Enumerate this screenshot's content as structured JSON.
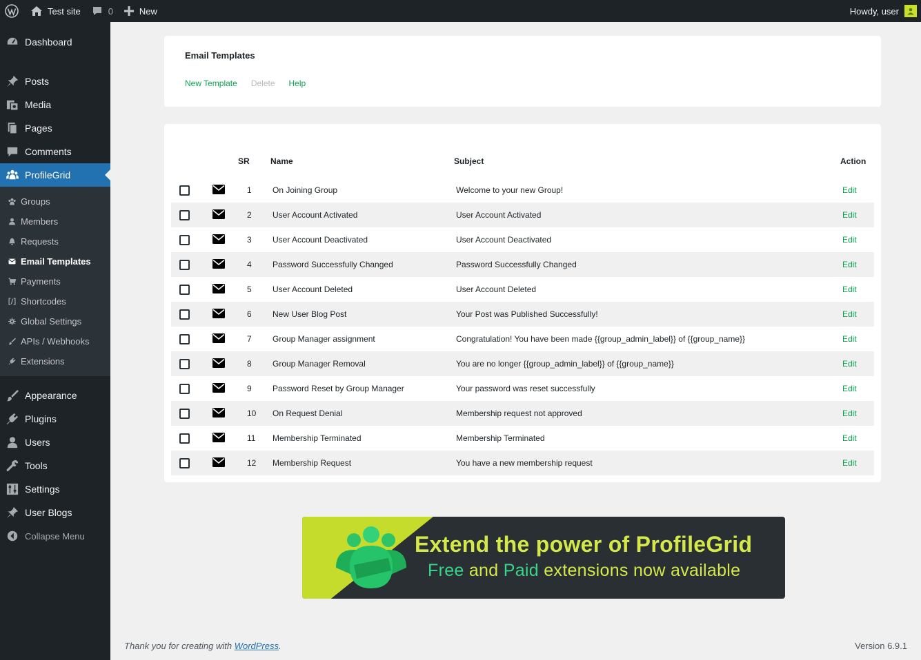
{
  "adminbar": {
    "site_name": "Test site",
    "comments_count": "0",
    "new_label": "New",
    "howdy": "Howdy, user"
  },
  "sidebar": {
    "top_items": [
      {
        "label": "Dashboard",
        "icon": "dashboard-icon"
      },
      {
        "label": "Posts",
        "icon": "pin-icon"
      },
      {
        "label": "Media",
        "icon": "media-icon"
      },
      {
        "label": "Pages",
        "icon": "pages-icon"
      },
      {
        "label": "Comments",
        "icon": "comment-icon"
      },
      {
        "label": "ProfileGrid",
        "icon": "groups-icon"
      }
    ],
    "sub_items": [
      {
        "label": "Groups",
        "icon": "groups-icon"
      },
      {
        "label": "Members",
        "icon": "user-icon"
      },
      {
        "label": "Requests",
        "icon": "bell-icon"
      },
      {
        "label": "Email Templates",
        "icon": "envelope-icon"
      },
      {
        "label": "Payments",
        "icon": "cart-icon"
      },
      {
        "label": "Shortcodes",
        "icon": "shortcode-icon"
      },
      {
        "label": "Global Settings",
        "icon": "gear-icon"
      },
      {
        "label": "APIs / Webhooks",
        "icon": "brush-icon"
      },
      {
        "label": "Extensions",
        "icon": "plug-icon"
      }
    ],
    "bottom_items": [
      {
        "label": "Appearance",
        "icon": "brush-icon"
      },
      {
        "label": "Plugins",
        "icon": "plug-icon"
      },
      {
        "label": "Users",
        "icon": "user-icon"
      },
      {
        "label": "Tools",
        "icon": "wrench-icon"
      },
      {
        "label": "Settings",
        "icon": "settings-icon"
      },
      {
        "label": "User Blogs",
        "icon": "pin-icon"
      }
    ],
    "collapse_label": "Collapse Menu"
  },
  "header": {
    "title": "Email Templates",
    "new_template": "New Template",
    "delete": "Delete",
    "help": "Help"
  },
  "table": {
    "columns": {
      "sr": "SR",
      "name": "Name",
      "subject": "Subject",
      "action": "Action"
    },
    "edit_label": "Edit",
    "rows": [
      {
        "sr": "1",
        "name": "On Joining Group",
        "subject": "Welcome to your new Group!"
      },
      {
        "sr": "2",
        "name": "User Account Activated",
        "subject": "User Account Activated"
      },
      {
        "sr": "3",
        "name": "User Account Deactivated",
        "subject": "User Account Deactivated"
      },
      {
        "sr": "4",
        "name": "Password Successfully Changed",
        "subject": "Password Successfully Changed"
      },
      {
        "sr": "5",
        "name": "User Account Deleted",
        "subject": "User Account Deleted"
      },
      {
        "sr": "6",
        "name": "New User Blog Post",
        "subject": "Your Post was Published Successfully!"
      },
      {
        "sr": "7",
        "name": "Group Manager assignment",
        "subject": "Congratulation! You have been made {{group_admin_label}} of {{group_name}}"
      },
      {
        "sr": "8",
        "name": "Group Manager Removal",
        "subject": "You are no longer {{group_admin_label}} of {{group_name}}"
      },
      {
        "sr": "9",
        "name": "Password Reset by Group Manager",
        "subject": "Your password was reset successfully"
      },
      {
        "sr": "10",
        "name": "On Request Denial",
        "subject": "Membership request not approved"
      },
      {
        "sr": "11",
        "name": "Membership Terminated",
        "subject": "Membership Terminated"
      },
      {
        "sr": "12",
        "name": "Membership Request",
        "subject": "You have a new membership request"
      }
    ]
  },
  "banner": {
    "line1": "Extend the power of ProfileGrid",
    "line2_highlight1": "Free",
    "line2_mid": " and ",
    "line2_highlight2": "Paid",
    "line2_end": " extensions now available"
  },
  "footer": {
    "thanks_prefix": "Thank you for creating with ",
    "wordpress_link": "WordPress",
    "thanks_suffix": ".",
    "version": "Version 6.9.1"
  },
  "colors": {
    "admin_dark": "#1d2327",
    "submenu_bg": "#2c3338",
    "current_blue": "#2271b1",
    "link_green": "#0aa34f",
    "banner_lime": "#c5dc2c"
  }
}
